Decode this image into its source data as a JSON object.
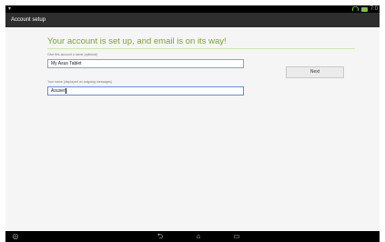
{
  "statusbar": {
    "left": "▾",
    "time": "7:0"
  },
  "actionbar": {
    "title": "Account setup"
  },
  "headline": "Your account is set up, and email is on its way!",
  "fields": {
    "account_name_label": "Give this account a name (optional)",
    "account_name_value": "My Asus Tablet",
    "your_name_label": "Your name (displayed on outgoing messages)",
    "your_name_value": "Asuser"
  },
  "buttons": {
    "next": "Next"
  },
  "nav": {
    "camera": "◎",
    "back": "⮌",
    "home": "⌂",
    "recents": "▭"
  },
  "colors": {
    "accent": "#7aa62a",
    "actionbar": "#2e2e2e",
    "focus": "#5b8de8"
  }
}
